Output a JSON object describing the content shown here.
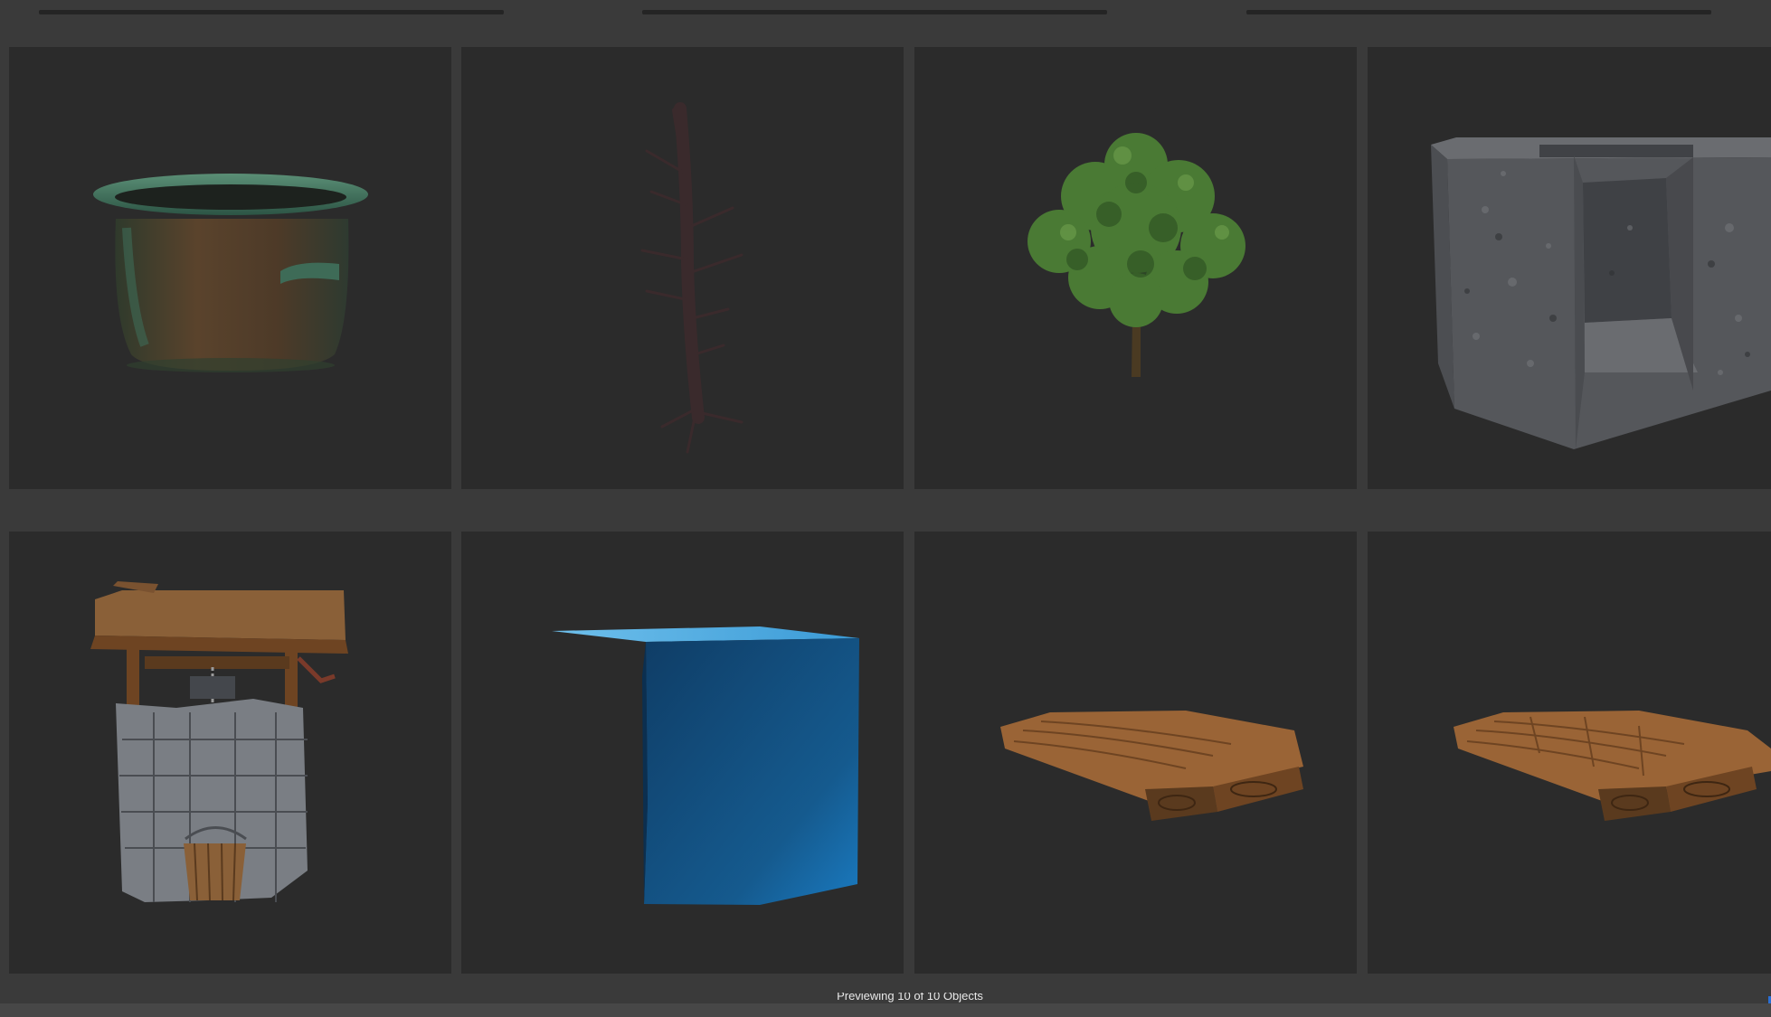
{
  "status": {
    "preview_text": "Previewing 10 of 10 Objects"
  },
  "tiles": [
    {
      "asset": "cooking-pot",
      "colors": [
        "#3e6b57",
        "#5a3f2a"
      ]
    },
    {
      "asset": "dead-tree",
      "colors": [
        "#3a2a2a"
      ]
    },
    {
      "asset": "leafy-tree",
      "colors": [
        "#4a7a34",
        "#4a3a22"
      ]
    },
    {
      "asset": "stone-block",
      "colors": [
        "#5e6064",
        "#3f4145"
      ]
    },
    {
      "asset": "stone-well",
      "colors": [
        "#8a8e94",
        "#8a6038"
      ]
    },
    {
      "asset": "blue-water-block",
      "colors": [
        "#15507e",
        "#6fc0ec"
      ]
    },
    {
      "asset": "wooden-planks",
      "colors": [
        "#9a6436",
        "#6e4422"
      ]
    },
    {
      "asset": "wooden-planks-cut",
      "colors": [
        "#9a6436",
        "#6e4422"
      ]
    }
  ],
  "colors": {
    "background": "#3a3a3a",
    "tile": "#2b2b2b",
    "accent": "#2a6fd6"
  }
}
